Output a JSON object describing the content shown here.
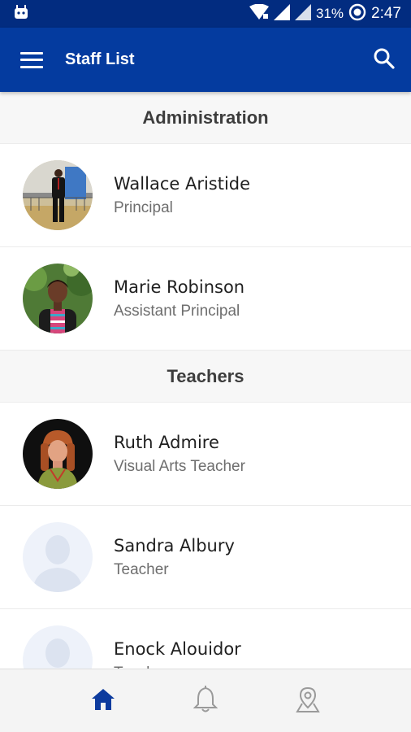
{
  "status_bar": {
    "battery": "31%",
    "time": "2:47"
  },
  "app_bar": {
    "title": "Staff List"
  },
  "sections": [
    {
      "title": "Administration",
      "staff": [
        {
          "name": "Wallace Aristide",
          "role": "Principal"
        },
        {
          "name": "Marie Robinson",
          "role": "Assistant Principal"
        }
      ]
    },
    {
      "title": "Teachers",
      "staff": [
        {
          "name": "Ruth Admire",
          "role": "Visual Arts Teacher"
        },
        {
          "name": "Sandra Albury",
          "role": "Teacher"
        },
        {
          "name": "Enock Alouidor",
          "role": "Teacher"
        }
      ]
    }
  ],
  "bottom_nav": [
    {
      "icon": "home-icon",
      "active": true
    },
    {
      "icon": "bell-icon",
      "active": false
    },
    {
      "icon": "map-pin-icon",
      "active": false
    }
  ],
  "colors": {
    "status_bar": "#022c80",
    "app_bar": "#043b9f",
    "nav_active": "#0d3b9e",
    "nav_inactive": "#9a9a9a",
    "placeholder_avatar": "#e8edf7"
  }
}
